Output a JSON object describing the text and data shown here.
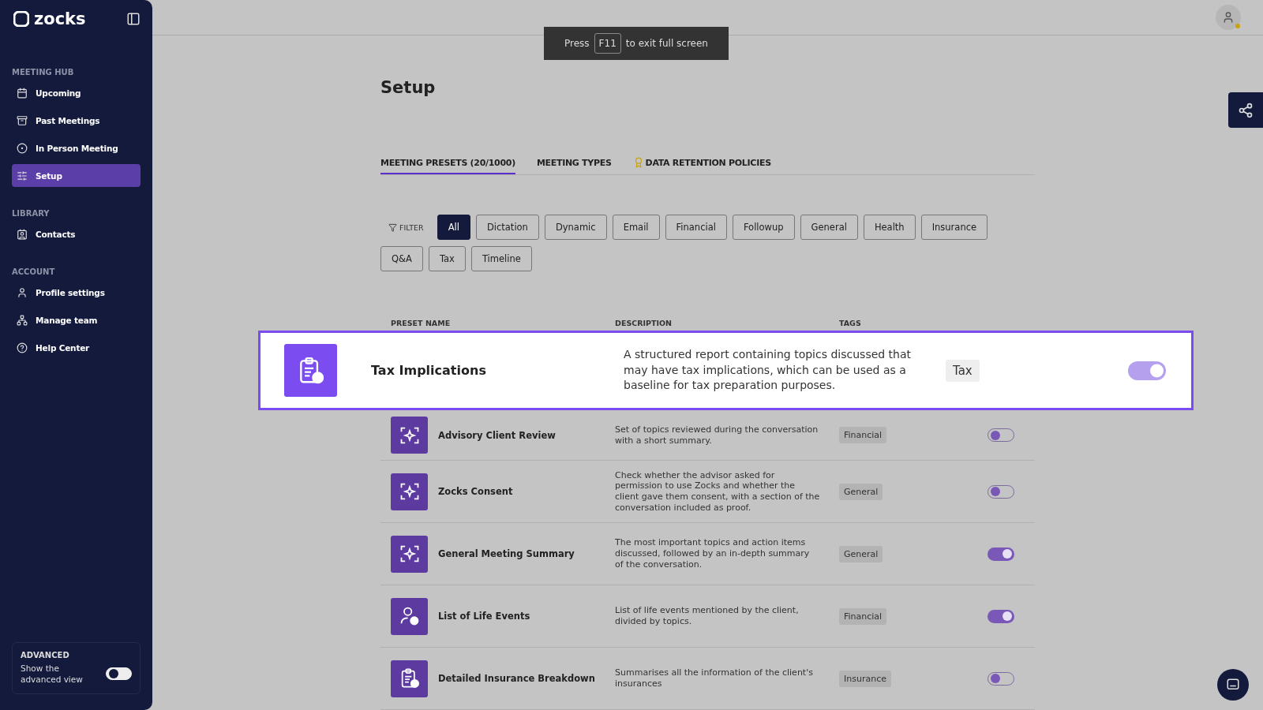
{
  "brand": "zocks",
  "sidebar": {
    "sections": [
      {
        "title": "MEETING HUB",
        "items": [
          {
            "label": "Upcoming",
            "kind": "calendar",
            "selected": false
          },
          {
            "label": "Past Meetings",
            "kind": "archive",
            "selected": false
          },
          {
            "label": "In Person Meeting",
            "kind": "record",
            "selected": false
          },
          {
            "label": "Setup",
            "kind": "sliders",
            "selected": true
          }
        ]
      },
      {
        "title": "LIBRARY",
        "items": [
          {
            "label": "Contacts",
            "kind": "contacts",
            "selected": false
          }
        ]
      },
      {
        "title": "ACCOUNT",
        "items": [
          {
            "label": "Profile settings",
            "kind": "user",
            "selected": false
          },
          {
            "label": "Manage team",
            "kind": "team",
            "selected": false
          },
          {
            "label": "Help Center",
            "kind": "help",
            "selected": false
          }
        ]
      }
    ],
    "advanced": {
      "title": "ADVANCED",
      "text": "Show the advanced view",
      "on": false
    }
  },
  "toast": {
    "before": "Press",
    "key": "F11",
    "after": "to exit full screen"
  },
  "title": "Setup",
  "tabs": [
    {
      "label": "MEETING PRESETS (20/1000)",
      "selected": true,
      "kind": "plain"
    },
    {
      "label": "MEETING TYPES",
      "selected": false,
      "kind": "plain"
    },
    {
      "label": "DATA RETENTION POLICIES",
      "selected": false,
      "kind": "badge"
    }
  ],
  "filter_label": "FILTER",
  "filters": [
    {
      "label": "All",
      "selected": true
    },
    {
      "label": "Dictation",
      "selected": false
    },
    {
      "label": "Dynamic",
      "selected": false
    },
    {
      "label": "Email",
      "selected": false
    },
    {
      "label": "Financial",
      "selected": false
    },
    {
      "label": "Followup",
      "selected": false
    },
    {
      "label": "General",
      "selected": false
    },
    {
      "label": "Health",
      "selected": false
    },
    {
      "label": "Insurance",
      "selected": false
    },
    {
      "label": "Q&A",
      "selected": false
    },
    {
      "label": "Tax",
      "selected": false
    },
    {
      "label": "Timeline",
      "selected": false
    }
  ],
  "columns": [
    "PRESET NAME",
    "DESCRIPTION",
    "TAGS"
  ],
  "highlighted": {
    "name": "Tax Implications",
    "description": "A structured report containing topics discussed that may have tax implications, which can be used as a baseline for tax preparation purposes.",
    "tag": "Tax",
    "on": true,
    "kind": "clipboard"
  },
  "rows": [
    {
      "name": "Advisory Client Review",
      "description": "Set of topics reviewed during the conversation with a short summary.",
      "tag": "Financial",
      "on": false,
      "kind": "sparkle"
    },
    {
      "name": "Zocks Consent",
      "description": "Check whether the advisor asked for permission to use Zocks and whether the client gave them consent, with a section of the conversation included as proof.",
      "tag": "General",
      "on": false,
      "kind": "sparkle"
    },
    {
      "name": "General Meeting Summary",
      "description": "The most important topics and action items discussed, followed by an in-depth summary of the conversation.",
      "tag": "General",
      "on": true,
      "kind": "sparkle"
    },
    {
      "name": "List of Life Events",
      "description": "List of life events mentioned by the client, divided by topics.",
      "tag": "Financial",
      "on": true,
      "kind": "person"
    },
    {
      "name": "Detailed Insurance Breakdown",
      "description": "Summarises all the information of the client's insurances",
      "tag": "Insurance",
      "on": false,
      "kind": "clipboard"
    }
  ]
}
